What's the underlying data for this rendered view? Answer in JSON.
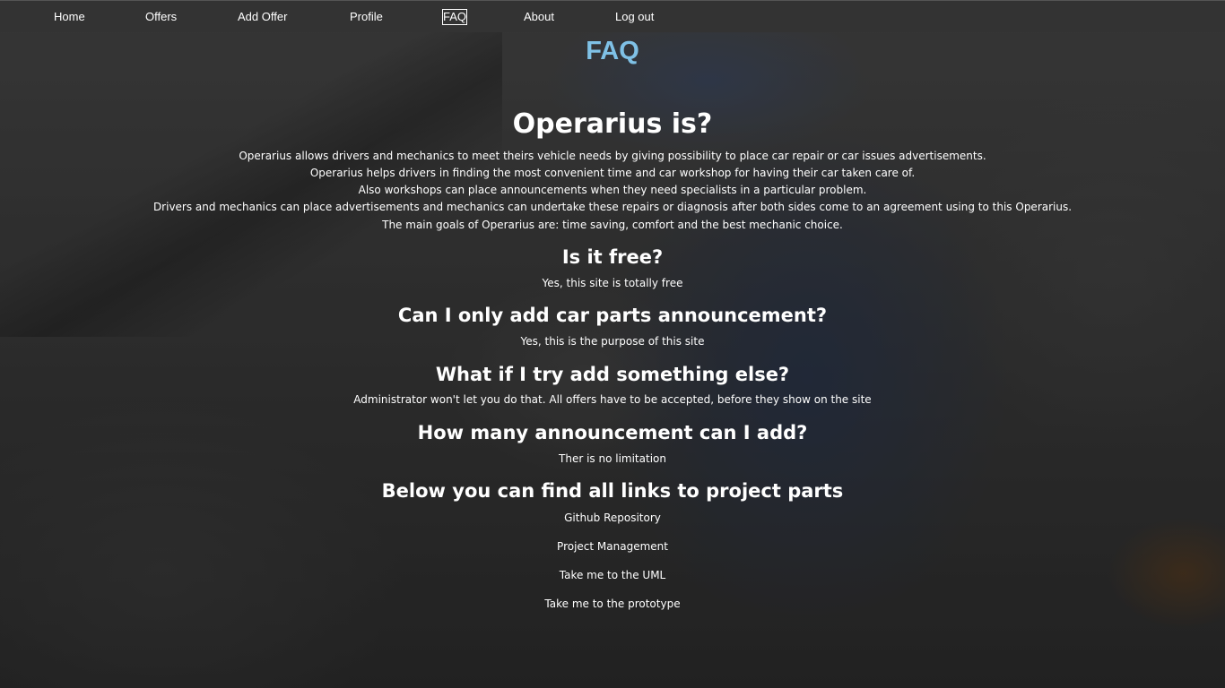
{
  "nav": {
    "items": [
      {
        "label": "Home"
      },
      {
        "label": "Offers"
      },
      {
        "label": "Add Offer"
      },
      {
        "label": "Profile"
      },
      {
        "label": "FAQ"
      },
      {
        "label": "About"
      },
      {
        "label": "Log out"
      }
    ],
    "active": "FAQ"
  },
  "page": {
    "title": "FAQ"
  },
  "faq": {
    "intro": {
      "heading": "Operarius is?",
      "lines": [
        "Operarius allows drivers and mechanics to meet theirs vehicle needs by giving possibility to place car repair or car issues advertisements.",
        "Operarius helps drivers in finding the most convenient time and car workshop for having their car taken care of.",
        "Also workshops can place announcements when they need specialists in a particular problem.",
        "Drivers and mechanics can place advertisements and mechanics can undertake these repairs or diagnosis after both sides come to an agreement using to this Operarius.",
        "The main goals of Operarius are: time saving, comfort and the best mechanic choice."
      ]
    },
    "questions": [
      {
        "question": "Is it free?",
        "answer": "Yes, this site is totally free"
      },
      {
        "question": "Can I only add car parts announcement?",
        "answer": "Yes, this is the purpose of this site"
      },
      {
        "question": "What if I try add something else?",
        "answer": "Administrator won't let you do that. All offers have to be accepted, before they show on the site"
      },
      {
        "question": "How many announcement can I add?",
        "answer": "Ther is no limitation"
      }
    ],
    "links": {
      "heading": "Below you can find all links to project parts",
      "items": [
        {
          "label": "Github Repository"
        },
        {
          "label": "Project Management"
        },
        {
          "label": "Take me to the UML"
        },
        {
          "label": "Take me to the prototype"
        }
      ]
    }
  },
  "colors": {
    "navbar_bg": "#333333",
    "title": "#7fc1e6",
    "text": "#ffffff"
  }
}
